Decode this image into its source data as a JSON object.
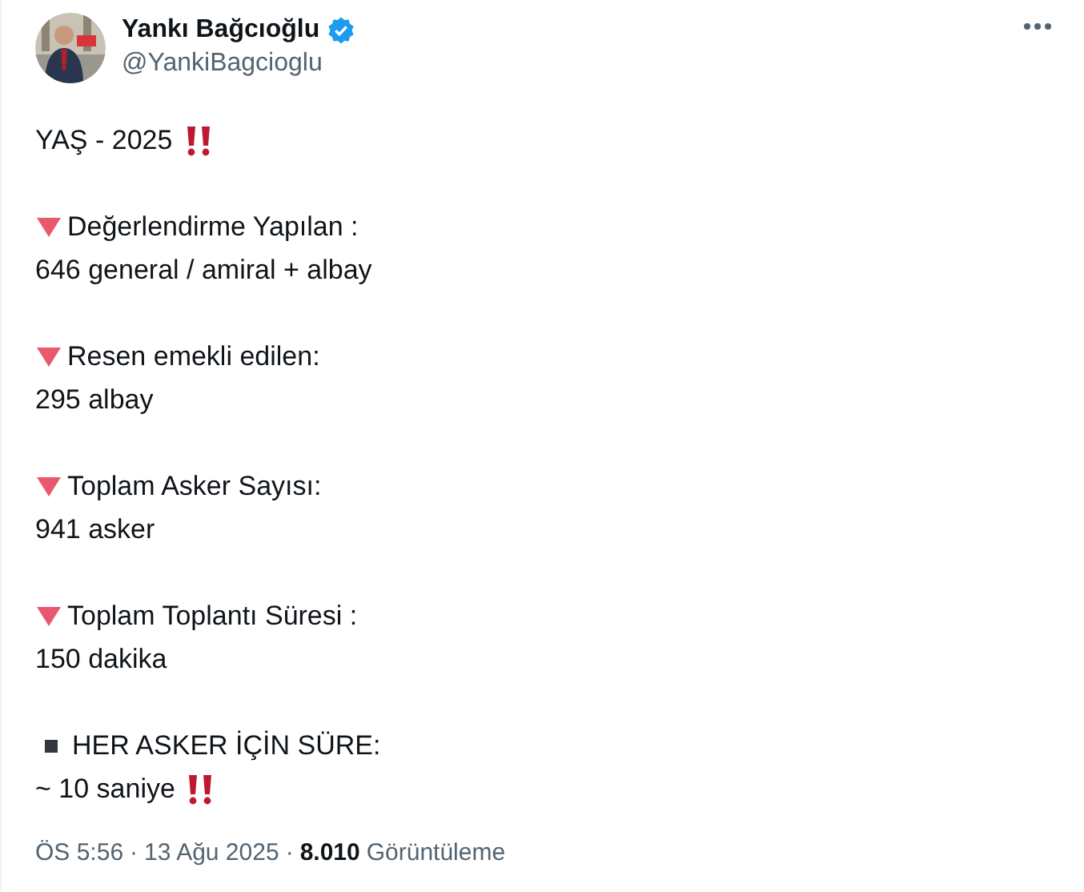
{
  "author": {
    "name": "Yankı Bağcıoğlu",
    "verified": true,
    "handle": "@YankiBagcioglu"
  },
  "paragraphs": [
    {
      "lines": [
        {
          "text": "YAŞ - 2025",
          "kind": "plain",
          "alert": true
        }
      ]
    },
    {
      "lines": [
        {
          "text": "Değerlendirme Yapılan :",
          "kind": "triangle",
          "alert": false
        },
        {
          "text": "646 general / amiral + albay",
          "kind": "plain",
          "alert": false
        }
      ]
    },
    {
      "lines": [
        {
          "text": "Resen emekli edilen:",
          "kind": "triangle",
          "alert": false
        },
        {
          "text": "295 albay",
          "kind": "plain",
          "alert": false
        }
      ]
    },
    {
      "lines": [
        {
          "text": "Toplam Asker Sayısı:",
          "kind": "triangle",
          "alert": false
        },
        {
          "text": "941 asker",
          "kind": "plain",
          "alert": false
        }
      ]
    },
    {
      "lines": [
        {
          "text": "Toplam Toplantı Süresi :",
          "kind": "triangle",
          "alert": false
        },
        {
          "text": "150 dakika",
          "kind": "plain",
          "alert": false
        }
      ]
    },
    {
      "lines": [
        {
          "text": "HER ASKER İÇİN SÜRE:",
          "kind": "square",
          "alert": false
        },
        {
          "text": "~ 10 saniye",
          "kind": "plain",
          "alert": true
        }
      ]
    }
  ],
  "meta": {
    "time": "ÖS 5:56",
    "separator_1": "·",
    "date": "13 Ağu 2025",
    "separator_2": "·",
    "views": "8.010",
    "views_label": "Görüntüleme"
  }
}
